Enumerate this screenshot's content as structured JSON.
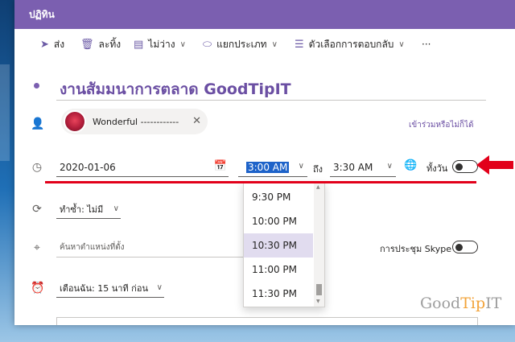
{
  "window": {
    "title": "ปฏิทิน",
    "accent": "#7b5fb0"
  },
  "toolbar": {
    "send": {
      "label": "ส่ง",
      "icon": "send-icon"
    },
    "discard": {
      "label": "ละทิ้ง",
      "icon": "trash-icon"
    },
    "busy": {
      "label": "ไม่ว่าง",
      "icon": "status-bar-icon"
    },
    "categorize": {
      "label": "แยกประเภท",
      "icon": "tag-icon"
    },
    "response_options": {
      "label": "ตัวเลือกการตอบกลับ",
      "icon": "response-options-icon"
    },
    "more": {
      "label": "···"
    }
  },
  "event": {
    "title": "งานสัมมนาการตลาด  GoodTipIT",
    "attendee": {
      "name": "Wonderful ------------"
    },
    "optional_link": "เข้าร่วมหรือไม่ก็ได้",
    "date": "2020-01-06",
    "start_time": "3:00 AM",
    "to_label": "ถึง",
    "end_time": "3:30 AM",
    "all_day_label": "ทั้งวัน",
    "all_day_on": false,
    "repeat": "ทำซ้ำ: ไม่มี",
    "location_placeholder": "ค้นหาตำแหน่งที่ตั้ง",
    "skype_label": "การประชุม Skype",
    "skype_on": false,
    "reminder": "เตือนฉัน: 15 นาที ก่อน"
  },
  "time_dropdown": {
    "options": [
      "9:30 PM",
      "10:00 PM",
      "10:30 PM",
      "11:00 PM",
      "11:30 PM"
    ],
    "selected_index": 2
  },
  "watermark": {
    "part1": "Good",
    "part2": "Tip",
    "part3": "IT"
  }
}
